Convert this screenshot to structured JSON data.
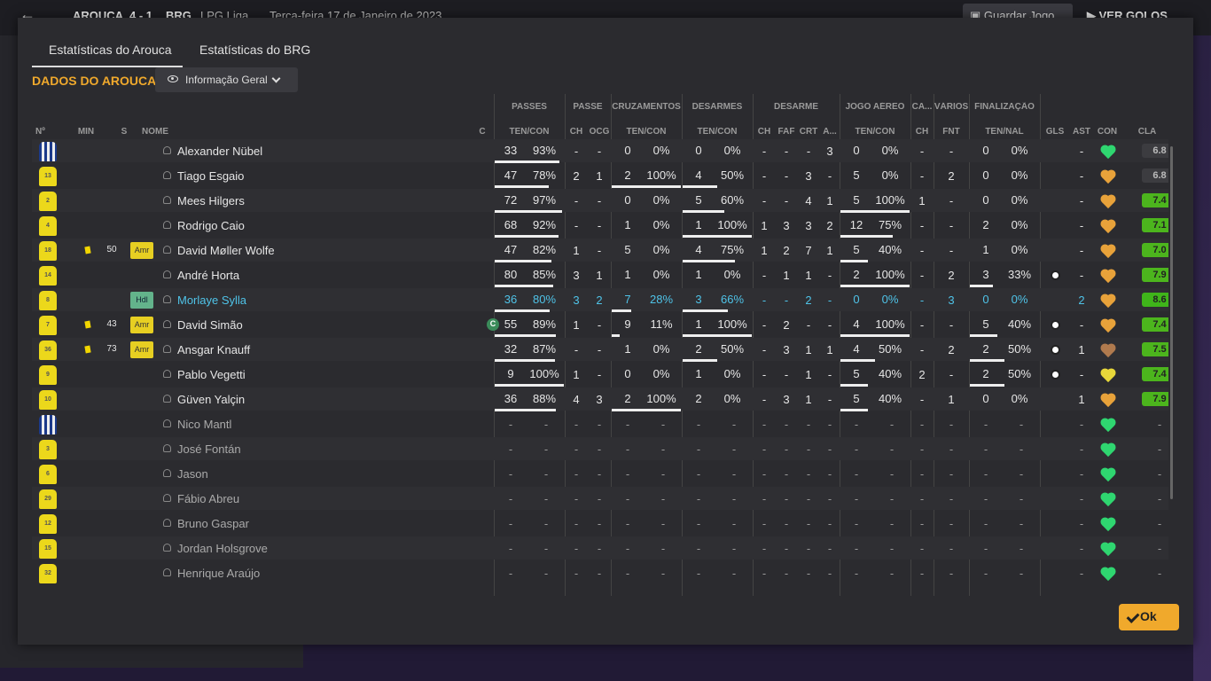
{
  "topbar": {
    "home_team": "AROUCA",
    "score": "4 - 1",
    "away_team": "BRG",
    "league": "LPG Liga",
    "date": "Terça-feira 17 de Janeiro de 2023",
    "save_label": "Guardar Jogo",
    "goals_label": "VER GOLOS"
  },
  "tabs": [
    {
      "label": "Estatísticas do Arouca"
    },
    {
      "label": "Estatísticas do BRG"
    }
  ],
  "section_title": "DADOS DO AROUCA",
  "view_dropdown": {
    "selected": "Informação Geral"
  },
  "group_headers": [
    "PASSES",
    "PASSE",
    "CRUZAMENTOS",
    "DESARMES",
    "DESARME",
    "JOGO AÉREO",
    "CA...",
    "VÁRIOS",
    "FINALIZAÇÃO"
  ],
  "column_headers": {
    "num": "Nº",
    "min": "MIN",
    "s": "S",
    "name": "NOME",
    "c": "C",
    "passes": "TEN/CON",
    "passe_ch": "CH",
    "passe_ocg": "OCG",
    "cruz": "TEN/CON",
    "desarmes": "TEN/CON",
    "des_ch": "CH",
    "des_faf": "FAF",
    "des_crt": "CRT",
    "des_a": "A...",
    "aereo": "TEN/CON",
    "ca_ch": "CH",
    "fnt": "FNT",
    "final": "TEN/NAL",
    "gls": "GLS",
    "ast": "AST",
    "con": "CON",
    "cla": "CLA"
  },
  "colors": {
    "accent": "#f0a92c",
    "link": "#4fc3e8",
    "heart_green": "#2fd670",
    "heart_orange": "#e8a23a",
    "rating_green": "#6bd22b"
  },
  "players": [
    {
      "num": "",
      "kit": "gk",
      "min": "",
      "card": false,
      "s": "",
      "name": "Alexander Nübel",
      "highlight": false,
      "captain": false,
      "p": [
        "33",
        "93%"
      ],
      "pf": 0.93,
      "ch": "-",
      "ocg": "-",
      "cr": [
        "0",
        "0%"
      ],
      "crf": 0,
      "de": [
        "0",
        "0%"
      ],
      "def": 0,
      "dch": "-",
      "faf": "-",
      "crt": "-",
      "da": "3",
      "ae": [
        "0",
        "0%"
      ],
      "aef": 0,
      "cach": "-",
      "fnt": "-",
      "fi": [
        "0",
        "0%"
      ],
      "fif": 0,
      "gls": false,
      "ast": "-",
      "con": "green",
      "cla": "6.8",
      "clabg": "#3c3c40"
    },
    {
      "num": "13",
      "kit": "y",
      "min": "",
      "card": false,
      "s": "",
      "name": "Tiago Esgaio",
      "highlight": false,
      "captain": false,
      "p": [
        "47",
        "78%"
      ],
      "pf": 0.78,
      "ch": "2",
      "ocg": "1",
      "cr": [
        "2",
        "100%"
      ],
      "crf": 1,
      "de": [
        "4",
        "50%"
      ],
      "def": 0.5,
      "dch": "-",
      "faf": "-",
      "crt": "3",
      "da": "-",
      "ae": [
        "5",
        "0%"
      ],
      "aef": 0,
      "cach": "-",
      "fnt": "2",
      "fi": [
        "0",
        "0%"
      ],
      "fif": 0,
      "gls": false,
      "ast": "-",
      "con": "orange",
      "cla": "6.8",
      "clabg": "#3c3c40"
    },
    {
      "num": "2",
      "kit": "y",
      "min": "",
      "card": false,
      "s": "",
      "name": "Mees Hilgers",
      "highlight": false,
      "captain": false,
      "p": [
        "72",
        "97%"
      ],
      "pf": 0.97,
      "ch": "-",
      "ocg": "-",
      "cr": [
        "0",
        "0%"
      ],
      "crf": 0,
      "de": [
        "5",
        "60%"
      ],
      "def": 0.6,
      "dch": "-",
      "faf": "-",
      "crt": "4",
      "da": "1",
      "ae": [
        "5",
        "100%"
      ],
      "aef": 1,
      "cach": "1",
      "fnt": "-",
      "fi": [
        "0",
        "0%"
      ],
      "fif": 0,
      "gls": false,
      "ast": "-",
      "con": "orange",
      "cla": "7.4",
      "clabg": "#4cb51d"
    },
    {
      "num": "4",
      "kit": "y",
      "min": "",
      "card": false,
      "s": "",
      "name": "Rodrigo Caio",
      "highlight": false,
      "captain": false,
      "p": [
        "68",
        "92%"
      ],
      "pf": 0.92,
      "ch": "-",
      "ocg": "-",
      "cr": [
        "1",
        "0%"
      ],
      "crf": 0,
      "de": [
        "1",
        "100%"
      ],
      "def": 1,
      "dch": "1",
      "faf": "3",
      "crt": "3",
      "da": "2",
      "ae": [
        "12",
        "75%"
      ],
      "aef": 0.75,
      "cach": "-",
      "fnt": "-",
      "fi": [
        "2",
        "0%"
      ],
      "fif": 0,
      "gls": false,
      "ast": "-",
      "con": "orange",
      "cla": "7.1",
      "clabg": "#4cb51d"
    },
    {
      "num": "18",
      "kit": "y",
      "min": "50",
      "card": true,
      "s": "Amr",
      "name": "David Møller Wolfe",
      "highlight": false,
      "captain": false,
      "p": [
        "47",
        "82%"
      ],
      "pf": 0.82,
      "ch": "1",
      "ocg": "-",
      "cr": [
        "5",
        "0%"
      ],
      "crf": 0,
      "de": [
        "4",
        "75%"
      ],
      "def": 0.75,
      "dch": "1",
      "faf": "2",
      "crt": "7",
      "da": "1",
      "ae": [
        "5",
        "40%"
      ],
      "aef": 0.4,
      "cach": "-",
      "fnt": "-",
      "fi": [
        "1",
        "0%"
      ],
      "fif": 0,
      "gls": false,
      "ast": "-",
      "con": "orange",
      "cla": "7.0",
      "clabg": "#4cb51d"
    },
    {
      "num": "14",
      "kit": "y",
      "min": "",
      "card": false,
      "s": "",
      "name": "André Horta",
      "highlight": false,
      "captain": false,
      "p": [
        "80",
        "85%"
      ],
      "pf": 0.85,
      "ch": "3",
      "ocg": "1",
      "cr": [
        "1",
        "0%"
      ],
      "crf": 0,
      "de": [
        "1",
        "0%"
      ],
      "def": 0,
      "dch": "-",
      "faf": "1",
      "crt": "1",
      "da": "-",
      "ae": [
        "2",
        "100%"
      ],
      "aef": 1,
      "cach": "-",
      "fnt": "2",
      "fi": [
        "3",
        "33%"
      ],
      "fif": 0.33,
      "gls": true,
      "ast": "-",
      "con": "orange",
      "cla": "7.9",
      "clabg": "#4cb51d"
    },
    {
      "num": "8",
      "kit": "y",
      "min": "",
      "card": false,
      "s": "Hdl",
      "name": "Morlaye Sylla",
      "highlight": true,
      "captain": false,
      "p": [
        "36",
        "80%"
      ],
      "pf": 0.8,
      "ch": "3",
      "ocg": "2",
      "cr": [
        "7",
        "28%"
      ],
      "crf": 0.28,
      "de": [
        "3",
        "66%"
      ],
      "def": 0.66,
      "dch": "-",
      "faf": "-",
      "crt": "2",
      "da": "-",
      "ae": [
        "0",
        "0%"
      ],
      "aef": 0,
      "cach": "-",
      "fnt": "3",
      "fi": [
        "0",
        "0%"
      ],
      "fif": 0,
      "gls": false,
      "ast": "2",
      "con": "orange",
      "cla": "8.6",
      "clabg": "#3fb51a"
    },
    {
      "num": "7",
      "kit": "y",
      "min": "43",
      "card": true,
      "s": "Amr",
      "name": "David Simão",
      "highlight": false,
      "captain": true,
      "p": [
        "55",
        "89%"
      ],
      "pf": 0.89,
      "ch": "1",
      "ocg": "-",
      "cr": [
        "9",
        "11%"
      ],
      "crf": 0.11,
      "de": [
        "1",
        "100%"
      ],
      "def": 1,
      "dch": "-",
      "faf": "2",
      "crt": "-",
      "da": "-",
      "ae": [
        "4",
        "100%"
      ],
      "aef": 1,
      "cach": "-",
      "fnt": "-",
      "fi": [
        "5",
        "40%"
      ],
      "fif": 0.4,
      "gls": true,
      "ast": "-",
      "con": "orange",
      "cla": "7.4",
      "clabg": "#4cb51d"
    },
    {
      "num": "36",
      "kit": "y",
      "min": "73",
      "card": true,
      "s": "Amr",
      "name": "Ansgar Knauff",
      "highlight": false,
      "captain": false,
      "p": [
        "32",
        "87%"
      ],
      "pf": 0.87,
      "ch": "-",
      "ocg": "-",
      "cr": [
        "1",
        "0%"
      ],
      "crf": 0,
      "de": [
        "2",
        "50%"
      ],
      "def": 0.5,
      "dch": "-",
      "faf": "3",
      "crt": "1",
      "da": "1",
      "ae": [
        "4",
        "50%"
      ],
      "aef": 0.5,
      "cach": "-",
      "fnt": "2",
      "fi": [
        "2",
        "50%"
      ],
      "fif": 0.5,
      "gls": true,
      "ast": "1",
      "con": "brown",
      "cla": "7.5",
      "clabg": "#4cb51d"
    },
    {
      "num": "9",
      "kit": "y",
      "min": "",
      "card": false,
      "s": "",
      "name": "Pablo Vegetti",
      "highlight": false,
      "captain": false,
      "p": [
        "9",
        "100%"
      ],
      "pf": 1,
      "ch": "1",
      "ocg": "-",
      "cr": [
        "0",
        "0%"
      ],
      "crf": 0,
      "de": [
        "1",
        "0%"
      ],
      "def": 0,
      "dch": "-",
      "faf": "-",
      "crt": "1",
      "da": "-",
      "ae": [
        "5",
        "40%"
      ],
      "aef": 0.4,
      "cach": "2",
      "fnt": "-",
      "fi": [
        "2",
        "50%"
      ],
      "fif": 0.5,
      "gls": true,
      "ast": "-",
      "con": "yellow",
      "cla": "7.4",
      "clabg": "#4cb51d"
    },
    {
      "num": "10",
      "kit": "y",
      "min": "",
      "card": false,
      "s": "",
      "name": "Güven Yalçin",
      "highlight": false,
      "captain": false,
      "p": [
        "36",
        "88%"
      ],
      "pf": 0.88,
      "ch": "4",
      "ocg": "3",
      "cr": [
        "2",
        "100%"
      ],
      "crf": 1,
      "de": [
        "2",
        "0%"
      ],
      "def": 0,
      "dch": "-",
      "faf": "3",
      "crt": "1",
      "da": "-",
      "ae": [
        "5",
        "40%"
      ],
      "aef": 0.4,
      "cach": "-",
      "fnt": "1",
      "fi": [
        "0",
        "0%"
      ],
      "fif": 0,
      "gls": false,
      "ast": "1",
      "con": "orange",
      "cla": "7.9",
      "clabg": "#4cb51d"
    }
  ],
  "subs": [
    {
      "num": "",
      "kit": "gk",
      "name": "Nico Mantl"
    },
    {
      "num": "3",
      "kit": "y",
      "name": "José Fontán"
    },
    {
      "num": "6",
      "kit": "y",
      "name": "Jason"
    },
    {
      "num": "29",
      "kit": "y",
      "name": "Fábio Abreu"
    },
    {
      "num": "12",
      "kit": "y",
      "name": "Bruno Gaspar"
    },
    {
      "num": "15",
      "kit": "y",
      "name": "Jordan Holsgrove"
    },
    {
      "num": "32",
      "kit": "y",
      "name": "Henrique Araújo"
    }
  ],
  "dash": "-",
  "ok_label": "Ok"
}
